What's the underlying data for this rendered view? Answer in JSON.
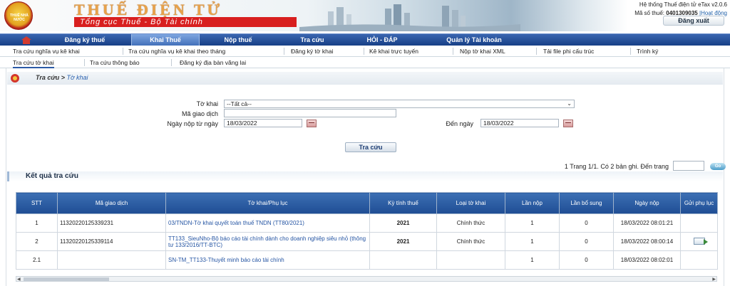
{
  "header": {
    "logo_text": "THUẾ NHÀ NƯỚC",
    "brand_title": "THUẾ ĐIỆN TỬ",
    "brand_subtitle": "Tổng cục Thuế - Bộ Tài chính",
    "system_name": "Hệ thống Thuế điện tử eTax v2.0.6",
    "tax_id_label": "Mã số thuế:",
    "tax_id": "0401309035",
    "activity_link": "|Hoạt động",
    "logout_label": "Đăng xuất"
  },
  "main_nav": {
    "items": [
      {
        "label": "Đăng ký thuế"
      },
      {
        "label": "Khai Thuế"
      },
      {
        "label": "Nộp thuế"
      },
      {
        "label": "Tra cứu"
      },
      {
        "label": "HỎI - ĐÁP"
      },
      {
        "label": "Quản lý Tài khoản"
      }
    ],
    "active": "Khai Thuế"
  },
  "sub_nav_1": {
    "items": [
      {
        "label": "Tra cứu nghĩa vụ kê khai"
      },
      {
        "label": "Tra cứu nghĩa vụ kê khai theo tháng"
      },
      {
        "label": "Đăng ký tờ khai"
      },
      {
        "label": "Kê khai trực tuyến"
      },
      {
        "label": "Nộp tờ khai XML"
      },
      {
        "label": "Tải file phi cấu trúc"
      },
      {
        "label": "Trình ký"
      }
    ]
  },
  "sub_nav_2": {
    "items": [
      {
        "label": "Tra cứu tờ khai"
      },
      {
        "label": "Tra cứu thông báo"
      },
      {
        "label": "Đăng ký địa bàn vãng lai"
      }
    ],
    "active": "Tra cứu tờ khai"
  },
  "breadcrumb": {
    "parent": "Tra cứu >",
    "current": "Tờ khai"
  },
  "form": {
    "to_khai_label": "Tờ khai",
    "to_khai_value": "--Tất cả--",
    "ma_giao_dich_label": "Mã giao dịch",
    "ma_giao_dich_value": "",
    "ngay_nop_tu_label": "Ngày nộp từ ngày",
    "ngay_nop_tu_value": "18/03/2022",
    "den_ngay_label": "Đến ngày",
    "den_ngay_value": "18/03/2022",
    "search_button": "Tra cứu"
  },
  "paging": {
    "text": "1 Trang 1/1. Có 2 bản ghi. Đến trang",
    "go_label": "Go"
  },
  "results": {
    "title": "Kết quả tra cứu",
    "columns": [
      "STT",
      "Mã giao dịch",
      "Tờ khai/Phụ lục",
      "Kỳ tính thuế",
      "Loại tờ khai",
      "Lần nộp",
      "Lần bổ sung",
      "Ngày nộp",
      "Gửi phụ lục"
    ],
    "rows": [
      {
        "stt": "1",
        "ma_gd": "11320220125339231",
        "to_khai": "03/TNDN-Tờ khai quyết toán thuế TNDN (TT80/2021)",
        "ky": "2021",
        "loai": "Chính thức",
        "lan_nop": "1",
        "lan_bs": "0",
        "ngay_nop": "18/03/2022 08:01:21",
        "has_send": false
      },
      {
        "stt": "2",
        "ma_gd": "11320220125339114",
        "to_khai": "TT133_SieuNho-Bộ báo cáo tài chính dành cho doanh nghiệp siêu nhỏ (thông tư 133/2016/TT-BTC)",
        "ky": "2021",
        "loai": "Chính thức",
        "lan_nop": "1",
        "lan_bs": "0",
        "ngay_nop": "18/03/2022 08:00:14",
        "has_send": true
      },
      {
        "stt": "2.1",
        "ma_gd": "",
        "to_khai": "SN-TM_TT133-Thuyết minh báo cáo tài chính",
        "ky": "",
        "loai": "",
        "lan_nop": "1",
        "lan_bs": "0",
        "ngay_nop": "18/03/2022 08:02:01",
        "has_send": false
      }
    ]
  },
  "colors": {
    "nav_blue": "#1f4d94",
    "brand_red": "#d81f1f",
    "link_blue": "#2555a3"
  }
}
